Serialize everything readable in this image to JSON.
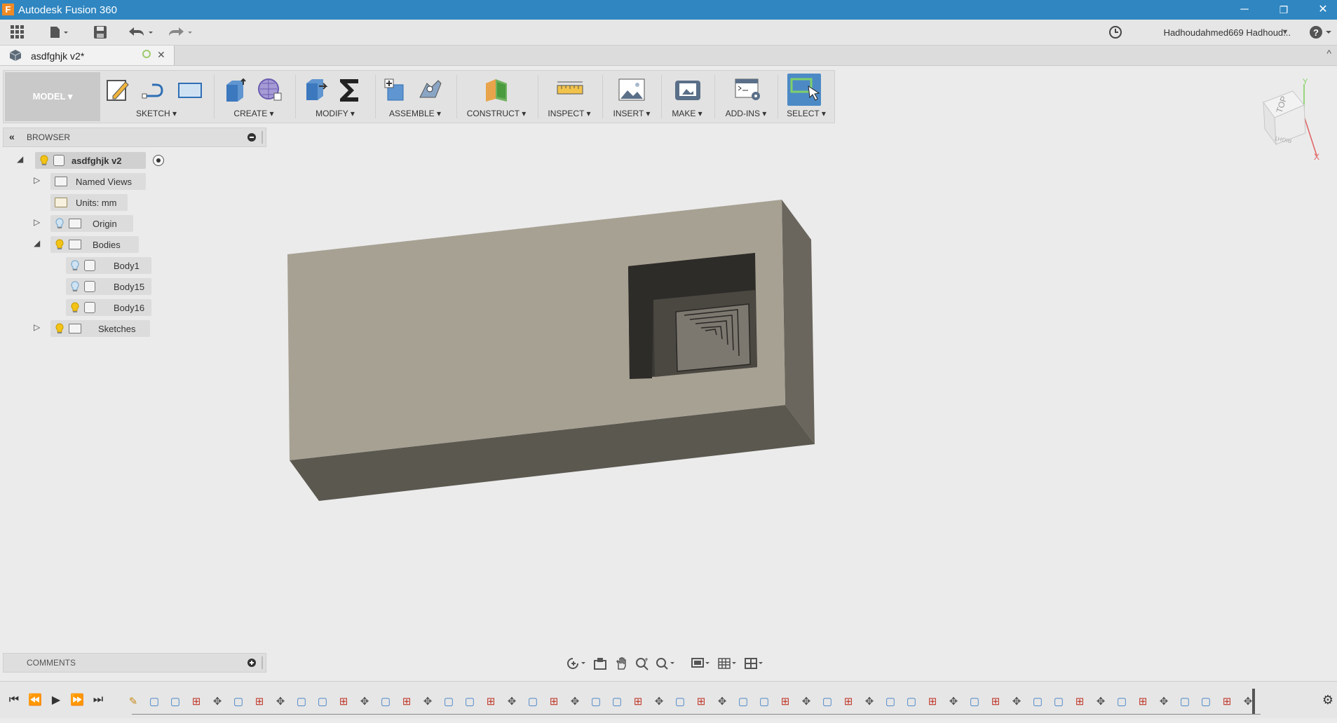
{
  "app": {
    "window_title": "Autodesk Fusion 360",
    "app_icon_letter": "F",
    "window_controls": {
      "minimize": "─",
      "restore": "❐",
      "close": "✕"
    }
  },
  "quick_access": {
    "data_panel_icon": "grid-icon",
    "file_icon": "file-icon",
    "save_icon": "save-icon",
    "undo_icon": "undo-icon",
    "redo_icon": "redo-icon",
    "job_status_icon": "clock-icon",
    "user": "Hadhoudahmed669 Hadhoud...",
    "help_icon": "help-icon"
  },
  "document_tab": {
    "label": "asdfghjk v2*",
    "close": "✕",
    "collapse": "^"
  },
  "workspace": {
    "label": "MODEL ▾"
  },
  "toolbar": {
    "groups": [
      {
        "label": "SKETCH ▾"
      },
      {
        "label": "CREATE ▾"
      },
      {
        "label": "MODIFY ▾"
      },
      {
        "label": "ASSEMBLE ▾"
      },
      {
        "label": "CONSTRUCT ▾"
      },
      {
        "label": "INSPECT ▾"
      },
      {
        "label": "INSERT ▾"
      },
      {
        "label": "MAKE ▾"
      },
      {
        "label": "ADD-INS ▾"
      },
      {
        "label": "SELECT ▾"
      }
    ]
  },
  "browser": {
    "title": "BROWSER",
    "collapse_icon": "«",
    "root": "asdfghjk v2",
    "nodes": {
      "named_views": "Named Views",
      "units": "Units: mm",
      "origin": "Origin",
      "bodies": "Bodies",
      "body1": "Body1",
      "body15": "Body15",
      "body16": "Body16",
      "sketches": "Sketches"
    }
  },
  "comments": {
    "title": "COMMENTS"
  },
  "viewcube": {
    "face_label": "TOP",
    "side_label": "RIGHT",
    "axis_x": "X",
    "axis_y": "Y"
  },
  "colors": {
    "titlebar": "#2f86c1",
    "body_top": "#a7a193",
    "body_side": "#6a665e",
    "body_front": "#5b5850",
    "select_active": "#4c8ac6"
  },
  "timeline": {
    "controls": [
      "first-icon",
      "prev-icon",
      "play-icon",
      "next-icon",
      "last-icon"
    ],
    "settings_icon": "gear-icon"
  }
}
